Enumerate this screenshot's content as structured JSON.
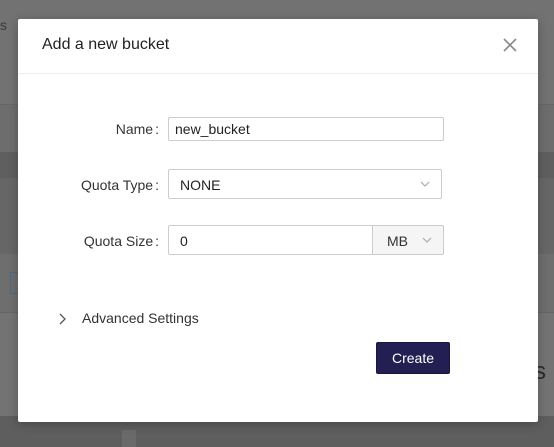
{
  "modal": {
    "title": "Add a new bucket",
    "close_icon": "close-icon"
  },
  "form": {
    "name": {
      "label": "Name",
      "colon": ":",
      "value": "new_bucket"
    },
    "quota_type": {
      "label": "Quota Type",
      "colon": ":",
      "value": "NONE",
      "icon": "chevron-down-icon"
    },
    "quota_size": {
      "label": "Quota Size",
      "colon": ":",
      "value": "0",
      "unit": "MB",
      "icon": "chevron-down-icon"
    }
  },
  "advanced": {
    "label": "Advanced Settings",
    "icon": "chevron-right-icon"
  },
  "actions": {
    "create_label": "Create"
  },
  "background": {
    "fragment_left": "s",
    "fragment_right": "s"
  },
  "colors": {
    "primary_button": "#231f52",
    "backdrop": "#6f6f6f"
  }
}
